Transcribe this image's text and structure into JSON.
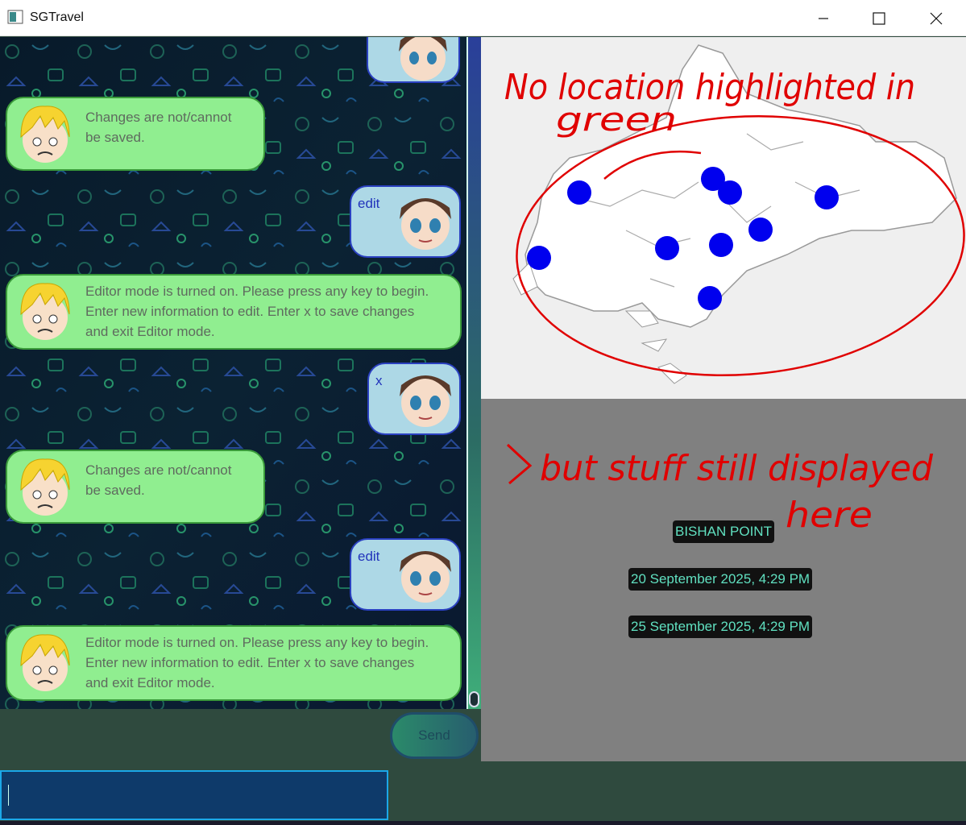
{
  "window": {
    "title": "SGTravel"
  },
  "chat": {
    "messages": [
      {
        "from": "bot",
        "text_lines": [
          "Changes are not/cannot",
          "be saved."
        ]
      },
      {
        "from": "user",
        "text": "edit"
      },
      {
        "from": "bot",
        "text_lines": [
          "Editor mode is turned on. Please press any key to begin.",
          "Enter new information to edit. Enter x to save changes",
          "and exit Editor mode."
        ]
      },
      {
        "from": "user",
        "text": "x"
      },
      {
        "from": "bot",
        "text_lines": [
          "Changes are not/cannot",
          "be saved."
        ]
      },
      {
        "from": "user",
        "text": "edit"
      },
      {
        "from": "bot",
        "text_lines": [
          "Editor mode is turned on. Please press any key to begin.",
          "Enter new information to edit. Enter x to save changes",
          "and exit Editor mode."
        ]
      }
    ]
  },
  "send_button": {
    "label": "Send"
  },
  "input": {
    "value": ""
  },
  "info": {
    "location": "BISHAN POINT",
    "start_date": "20 September 2025, 4:29 PM",
    "end_date": "25 September 2025, 4:29 PM"
  },
  "annotations": {
    "map_note_line1": "No location highlighted in",
    "map_note_line2": "green",
    "info_note_line1": "but stuff still displayed",
    "info_note_line2": "here",
    "ink_color": "#e00000"
  },
  "colors": {
    "bot_bubble": "#90ee90",
    "user_bubble": "#add8e6",
    "map_marker": "#0000ee"
  }
}
